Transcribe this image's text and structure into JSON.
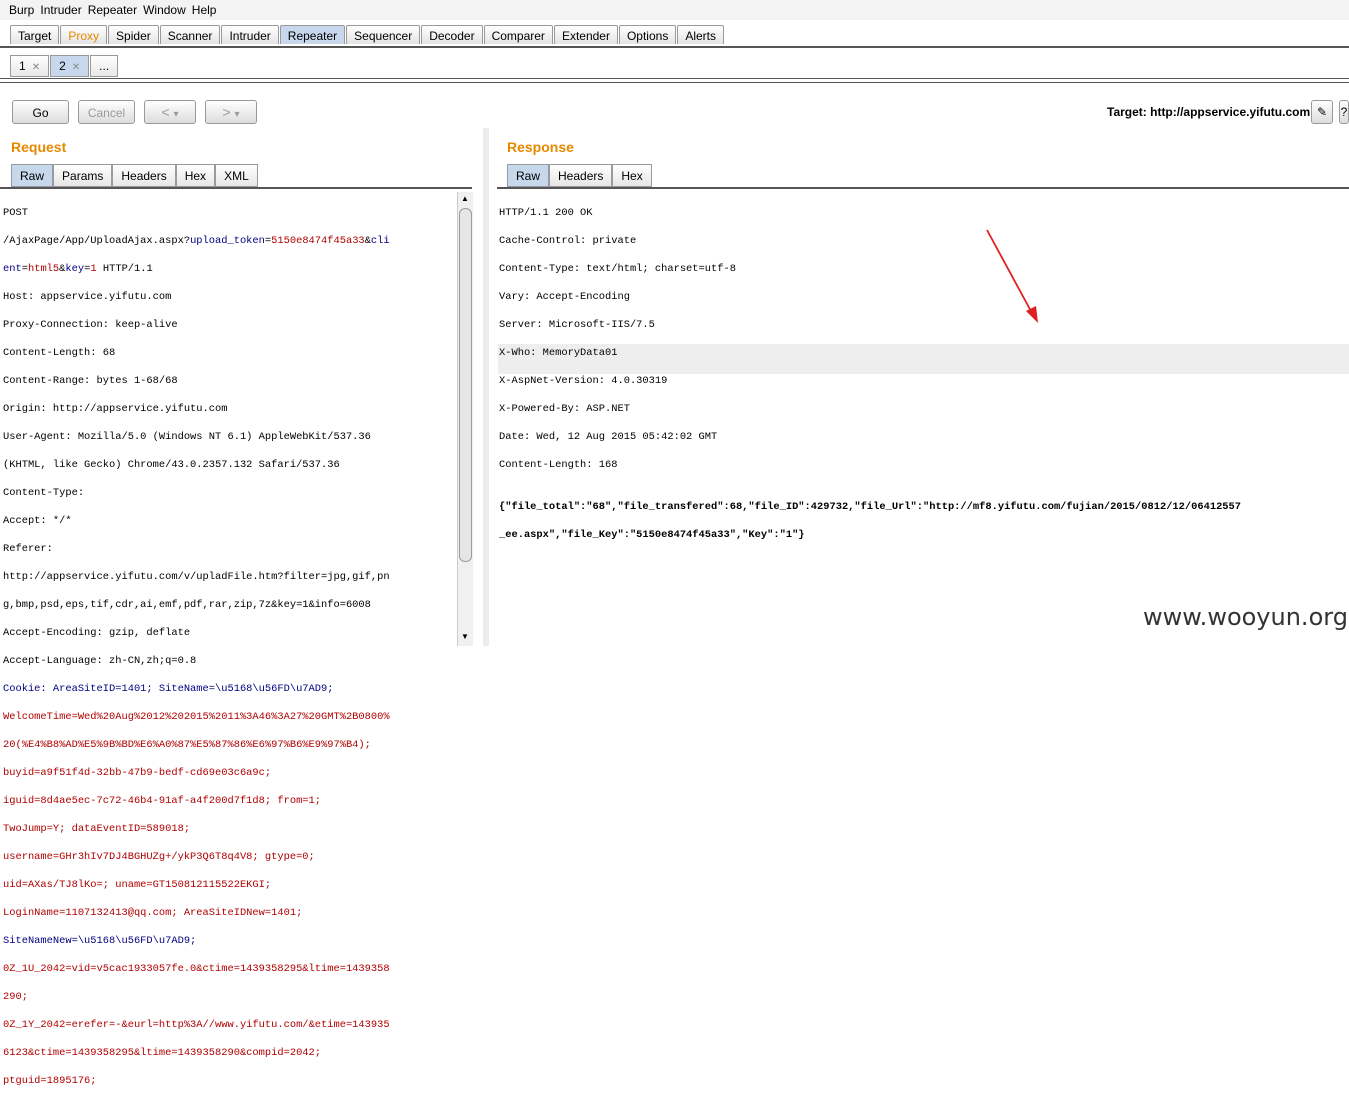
{
  "menu": [
    "Burp",
    "Intruder",
    "Repeater",
    "Window",
    "Help"
  ],
  "main_tabs": [
    "Target",
    "Proxy",
    "Spider",
    "Scanner",
    "Intruder",
    "Repeater",
    "Sequencer",
    "Decoder",
    "Comparer",
    "Extender",
    "Options",
    "Alerts"
  ],
  "sub_tabs": [
    "1",
    "2",
    "..."
  ],
  "toolbar": {
    "go": "Go",
    "cancel": "Cancel",
    "back": "<",
    "back_drop": "▾",
    "fwd": ">",
    "fwd_drop": "▾",
    "target": "Target: http://appservice.yifutu.com",
    "help": "?"
  },
  "request": {
    "title": "Request",
    "tabs": [
      "Raw",
      "Params",
      "Headers",
      "Hex",
      "XML"
    ]
  },
  "response": {
    "title": "Response",
    "tabs": [
      "Raw",
      "Headers",
      "Hex"
    ]
  },
  "request_lines": [
    "POST",
    "/AjaxPage/App/UploadAjax.aspx?upload_token=5150e8474f45a33&cli",
    "ent=html5&key=1 HTTP/1.1",
    "Host: appservice.yifutu.com",
    "Proxy-Connection: keep-alive",
    "Content-Length: 68",
    "Content-Range: bytes 1-68/68",
    "Origin: http://appservice.yifutu.com",
    "User-Agent: Mozilla/5.0 (Windows NT 6.1) AppleWebKit/537.36",
    "(KHTML, like Gecko) Chrome/43.0.2357.132 Safari/537.36",
    "Content-Type:",
    "Accept: */*",
    "Referer:",
    "http://appservice.yifutu.com/v/upladFile.htm?filter=jpg,gif,pn",
    "g,bmp,psd,eps,tif,cdr,ai,emf,pdf,rar,zip,7z&key=1&info=6008",
    "Accept-Encoding: gzip, deflate",
    "Accept-Language: zh-CN,zh;q=0.8",
    "Cookie: AreaSiteID=1401; SiteName=\\u5168\\u56FD\\u7AD9;",
    "WelcomeTime=Wed%20Aug%2012%202015%2011%3A46%3A27%20GMT%2B0800%",
    "20(%E4%B8%AD%E5%9B%BD%E6%A0%87%E5%87%86%E6%97%B6%E9%97%B4);",
    "buyid=a9f51f4d-32bb-47b9-bedf-cd69e03c6a9c;",
    "iguid=8d4ae5ec-7c72-46b4-91af-a4f200d7f1d8; from=1;",
    "TwoJump=Y; dataEventID=589018;",
    "username=GHr3hIv7DJ4BGHUZg+/ykP3Q6T8q4V8; gtype=0;",
    "uid=AXas/TJ8lKo=; uname=GT150812115522EKGI;",
    "LoginName=1107132413@qq.com; AreaSiteIDNew=1401;",
    "SiteNameNew=\\u5168\\u56FD\\u7AD9;",
    "0Z_1U_2042=vid=v5cac1933057fe.0&ctime=1439358295&ltime=1439358",
    "290;",
    "0Z_1Y_2042=erefer=-&eurl=http%3A//www.yifutu.com/&etime=143935",
    "6123&ctime=1439358295&ltime=1439358290&compid=2042;",
    "ptguid=1895176;"
  ],
  "response_lines": [
    "HTTP/1.1 200 OK",
    "Cache-Control: private",
    "Content-Type: text/html; charset=utf-8",
    "Vary: Accept-Encoding",
    "Server: Microsoft-IIS/7.5",
    "X-Who: MemoryData01",
    "X-AspNet-Version: 4.0.30319",
    "X-Powered-By: ASP.NET",
    "Date: Wed, 12 Aug 2015 05:42:02 GMT",
    "Content-Length: 168",
    "",
    "{\"file_total\":\"68\",\"file_transfered\":68,\"file_ID\":429732,\"file_Url\":\"http://mf8.yifutu.com/fujian/2015/0812/12/06412557",
    "_ee.aspx\",\"file_Key\":\"5150e8474f45a33\",\"Key\":\"1\"}"
  ],
  "watermark": "www.wooyun.org",
  "colors": {
    "accent": "#e58a00",
    "selected_tab": "#c8d8ec",
    "key": "#000080",
    "value": "#b00000"
  }
}
